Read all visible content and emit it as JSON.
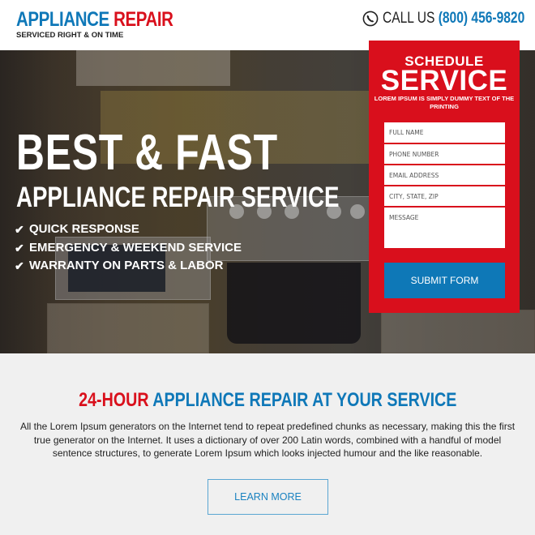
{
  "header": {
    "logo_part1": "APPLIANCE",
    "logo_part2": "REPAIR",
    "tagline": "SERVICED RIGHT & ON TIME",
    "call_label": "CALL US",
    "phone": "(800) 456-9820",
    "phone_icon": "phone-icon"
  },
  "hero": {
    "title": "BEST & FAST",
    "subtitle": "APPLIANCE REPAIR SERVICE",
    "check_icon": "check-icon",
    "features": [
      "QUICK RESPONSE",
      "EMERGENCY & WEEKEND SERVICE",
      "WARRANTY ON PARTS & LABOR"
    ]
  },
  "form": {
    "heading_small": "SCHEDULE",
    "heading_large": "SERVICE",
    "note": "LOREM IPSUM IS SIMPLY DUMMY TEXT OF THE PRINTING",
    "fields": {
      "full_name": {
        "placeholder": "FULL NAME",
        "value": ""
      },
      "phone": {
        "placeholder": "PHONE NUMBER",
        "value": ""
      },
      "email": {
        "placeholder": "EMAIL ADDRESS",
        "value": ""
      },
      "city": {
        "placeholder": "CITY, STATE, ZIP",
        "value": ""
      },
      "message": {
        "placeholder": "MESSAGE",
        "value": ""
      }
    },
    "submit_label": "SUBMIT FORM"
  },
  "section": {
    "title_highlight": "24-HOUR",
    "title_rest": "APPLIANCE REPAIR AT YOUR SERVICE",
    "body": "All the Lorem Ipsum generators on the Internet tend to repeat predefined chunks as necessary, making this the first true generator on the Internet. It uses a dictionary of over 200 Latin words, combined with a handful of model sentence structures, to generate Lorem Ipsum which looks injected humour and the like reasonable.",
    "button_label": "LEARN MORE"
  },
  "colors": {
    "brand_blue": "#0f78b8",
    "brand_red": "#d9101c",
    "panel_red": "#d90f1c",
    "submit_blue": "#0e78b7",
    "section_bg": "#f0f0f0"
  }
}
